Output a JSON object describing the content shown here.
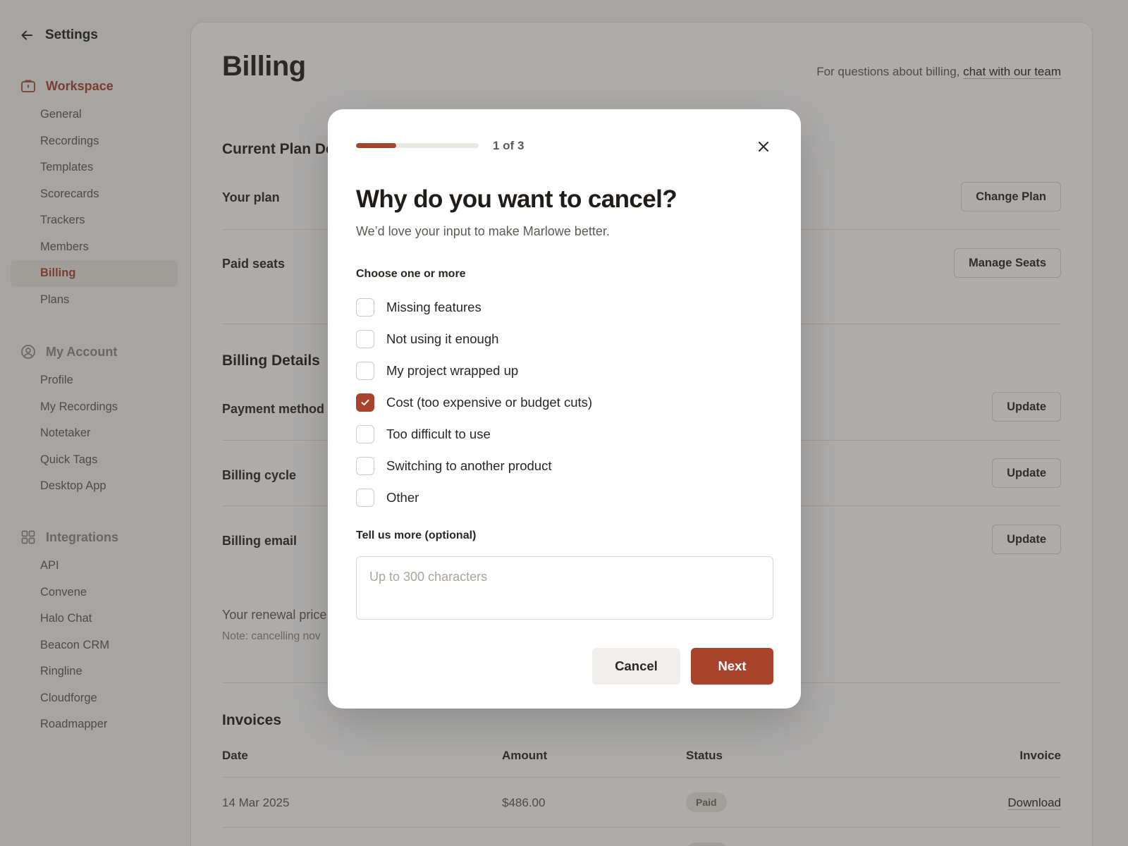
{
  "sidebar": {
    "title": "Settings",
    "sections": [
      {
        "label": "Workspace",
        "icon": "briefcase-icon",
        "active": true,
        "items": [
          {
            "label": "General"
          },
          {
            "label": "Recordings"
          },
          {
            "label": "Templates"
          },
          {
            "label": "Scorecards"
          },
          {
            "label": "Trackers"
          },
          {
            "label": "Members"
          },
          {
            "label": "Billing",
            "active": true
          },
          {
            "label": "Plans"
          }
        ]
      },
      {
        "label": "My Account",
        "icon": "user-circle-icon",
        "items": [
          {
            "label": "Profile"
          },
          {
            "label": "My Recordings"
          },
          {
            "label": "Notetaker"
          },
          {
            "label": "Quick Tags"
          },
          {
            "label": "Desktop App"
          }
        ]
      },
      {
        "label": "Integrations",
        "icon": "grid-icon",
        "items": [
          {
            "label": "API"
          },
          {
            "label": "Convene"
          },
          {
            "label": "Halo Chat"
          },
          {
            "label": "Beacon CRM"
          },
          {
            "label": "Ringline"
          },
          {
            "label": "Cloudforge"
          },
          {
            "label": "Roadmapper"
          }
        ]
      }
    ]
  },
  "main": {
    "title": "Billing",
    "help_prefix": "For questions about billing, ",
    "help_link": "chat with our team",
    "current_plan_title": "Current Plan De",
    "your_plan_label": "Your plan",
    "change_plan_btn": "Change Plan",
    "paid_seats_label": "Paid seats",
    "manage_seats_btn": "Manage Seats",
    "billing_details_title": "Billing Details",
    "payment_method_label": "Payment method",
    "billing_cycle_label": "Billing cycle",
    "billing_email_label": "Billing email",
    "update_btn": "Update",
    "renewal_text": "Your renewal price",
    "note_text": "Note: cancelling nov",
    "invoices_title": "Invoices",
    "invoices": {
      "headers": {
        "date": "Date",
        "amount": "Amount",
        "status": "Status",
        "invoice": "Invoice"
      },
      "rows": [
        {
          "date": "14 Mar 2025",
          "amount": "$486.00",
          "status": "Paid",
          "action": "Download"
        }
      ]
    }
  },
  "modal": {
    "progress": 0.33,
    "step_text": "1 of 3",
    "title": "Why do you want to cancel?",
    "subtitle": "We’d love your input to make Marlowe better.",
    "choose_label": "Choose one or more",
    "options": [
      {
        "label": "Missing features",
        "checked": false
      },
      {
        "label": "Not using it enough",
        "checked": false
      },
      {
        "label": "My project wrapped up",
        "checked": false
      },
      {
        "label": "Cost (too expensive or budget cuts)",
        "checked": true
      },
      {
        "label": "Too difficult to use",
        "checked": false
      },
      {
        "label": "Switching to another product",
        "checked": false
      },
      {
        "label": "Other",
        "checked": false
      }
    ],
    "more_label": "Tell us more (optional)",
    "textarea_placeholder": "Up to 300 characters",
    "cancel_btn": "Cancel",
    "next_btn": "Next"
  },
  "colors": {
    "accent": "#a8432c",
    "background": "#f4f3f0"
  }
}
